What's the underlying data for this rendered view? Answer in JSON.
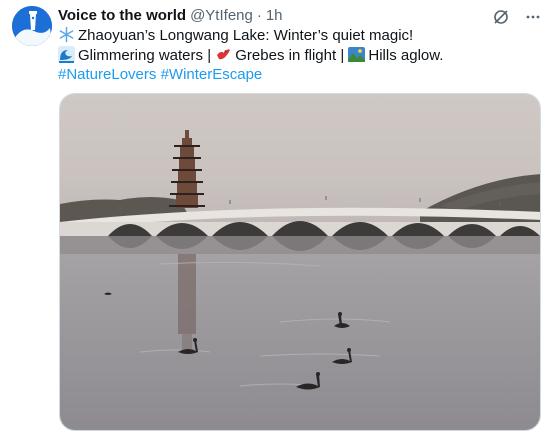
{
  "tweet": {
    "author_name": "Voice to the world",
    "handle": "@YtIfeng",
    "separator": "·",
    "time": "1h",
    "line1": "Zhaoyuan’s Longwang Lake: Winter’s quiet magic!",
    "line2_a": "Glimmering waters |",
    "line2_b": "Grebes in flight |",
    "line2_c": "Hills aglow.",
    "hashtag1": "#NatureLovers",
    "hashtag2": "#WinterEscape"
  },
  "icons": {
    "grok": "grok-icon",
    "more": "more-icon",
    "line1_emoji": "snowflake-icon",
    "wave_emoji": "wave-icon",
    "bird_emoji": "bird-icon",
    "hills_emoji": "landscape-icon"
  },
  "colors": {
    "accent": "#1d9bf0",
    "text": "#0f1419",
    "muted": "#536471"
  }
}
